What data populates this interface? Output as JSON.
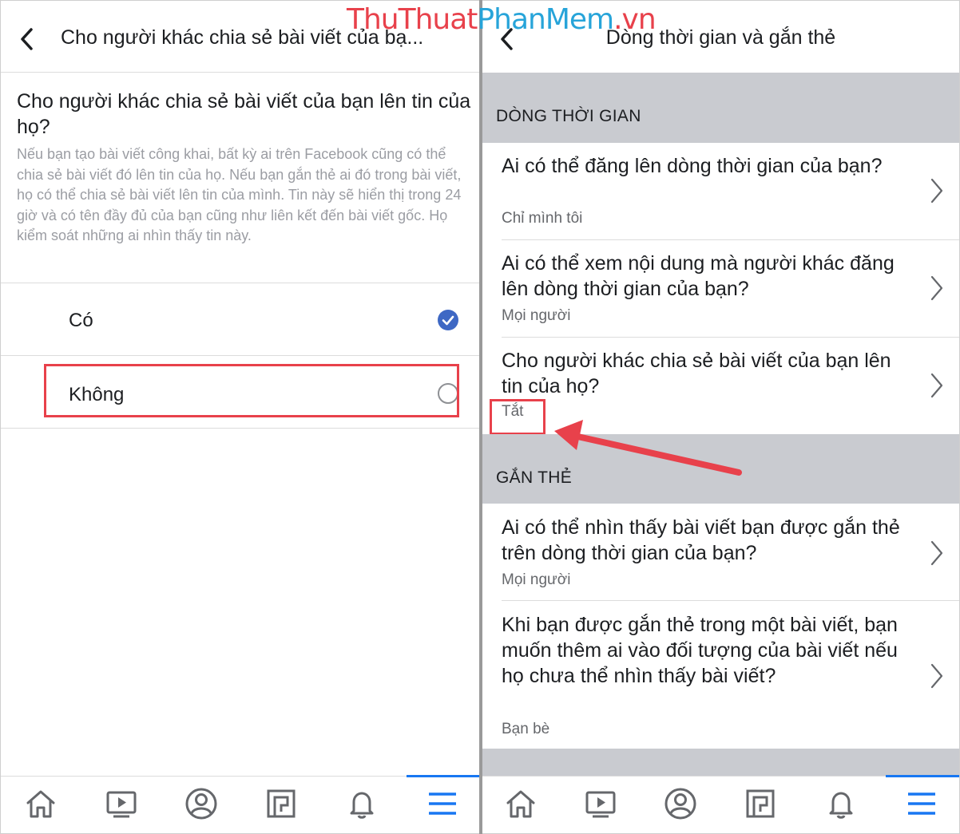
{
  "watermark": {
    "text_part1": "ThuThuat",
    "text_part2": "PhanMem",
    "text_part3": ".vn",
    "color_red": "#e8414b",
    "color_blue": "#27a4d9"
  },
  "left_panel": {
    "header": {
      "title": "Cho người khác chia sẻ bài viết của bạ..."
    },
    "question": "Cho người khác chia sẻ bài viết của bạn lên tin của họ?",
    "description": "Nếu bạn tạo bài viết công khai, bất kỳ ai trên Facebook cũng có thể chia sẻ bài viết đó lên tin của họ. Nếu bạn gắn thẻ ai đó trong bài viết, họ có thể chia sẻ bài viết lên tin của mình. Tin này sẽ hiển thị trong 24 giờ và có tên đầy đủ của bạn cũng như liên kết đến bài viết gốc. Họ kiểm soát những ai nhìn thấy tin này.",
    "options": [
      {
        "label": "Có",
        "selected": true
      },
      {
        "label": "Không",
        "selected": false
      }
    ]
  },
  "right_panel": {
    "header": {
      "title": "Dòng thời gian và gắn thẻ"
    },
    "sections": [
      {
        "heading": "DÒNG THỜI GIAN",
        "items": [
          {
            "question": "Ai có thể đăng lên dòng thời gian của bạn?",
            "value": "Chỉ mình tôi"
          },
          {
            "question": "Ai có thể xem nội dung mà người khác đăng lên dòng thời gian của bạn?",
            "value": "Mọi người"
          },
          {
            "question": "Cho người khác chia sẻ bài viết của bạn lên tin của họ?",
            "value": "Tắt"
          }
        ]
      },
      {
        "heading": "GẮN THẺ",
        "items": [
          {
            "question": "Ai có thể nhìn thấy bài viết bạn được gắn thẻ trên dòng thời gian của bạn?",
            "value": "Mọi người"
          },
          {
            "question": "Khi bạn được gắn thẻ trong một bài viết, bạn muốn thêm ai vào đối tượng của bài viết nếu họ chưa thể nhìn thấy bài viết?",
            "value": "Bạn bè"
          }
        ]
      }
    ]
  },
  "bottom_nav": {
    "items": [
      "home-icon",
      "watch-icon",
      "profile-icon",
      "pages-icon",
      "notifications-icon",
      "menu-icon"
    ],
    "active": "menu-icon"
  },
  "colors": {
    "accent": "#1877f2",
    "checkbox_blue": "#3e68c4",
    "annotation_red": "#e8414b",
    "section_gray": "#c9cbd0"
  }
}
